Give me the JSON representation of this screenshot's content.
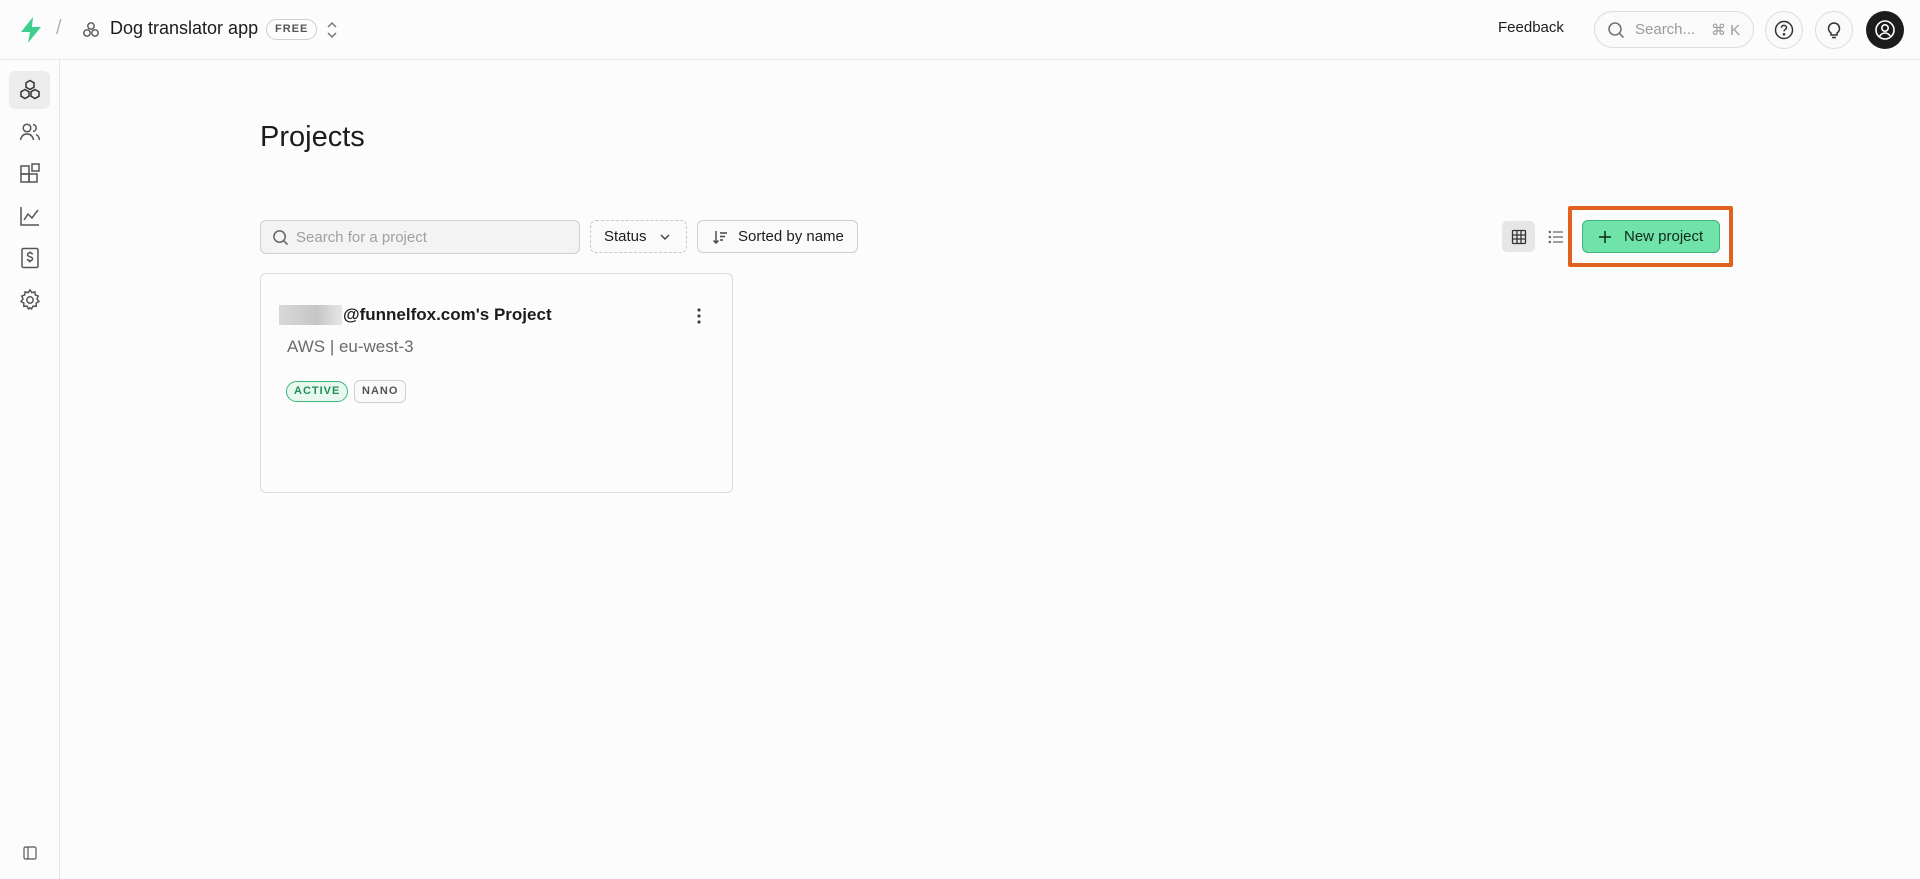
{
  "header": {
    "org_name": "Dog translator app",
    "plan_badge": "FREE",
    "feedback_label": "Feedback",
    "search_placeholder": "Search...",
    "search_shortcut": "⌘ K",
    "icons": [
      "bolt-logo-icon",
      "org-icon",
      "chevron-updown-icon",
      "search-icon",
      "help-icon",
      "lightbulb-icon",
      "user-avatar-icon"
    ]
  },
  "sidebar": {
    "items": [
      {
        "name": "projects",
        "icon": "cubes-icon",
        "active": true
      },
      {
        "name": "team",
        "icon": "users-icon",
        "active": false
      },
      {
        "name": "integrations",
        "icon": "blocks-icon",
        "active": false
      },
      {
        "name": "usage",
        "icon": "chart-icon",
        "active": false
      },
      {
        "name": "billing",
        "icon": "receipt-icon",
        "active": false
      },
      {
        "name": "settings",
        "icon": "gear-icon",
        "active": false
      }
    ],
    "footer_icon": "panel-toggle-icon"
  },
  "main": {
    "title": "Projects",
    "search_placeholder": "Search for a project",
    "status_filter_label": "Status",
    "sort_label": "Sorted by name",
    "new_project_label": "New project",
    "view_mode": "grid"
  },
  "projects": [
    {
      "title": "@funnelfox.com's Project",
      "subtitle": "AWS | eu-west-3",
      "status_badge": "ACTIVE",
      "size_badge": "NANO"
    }
  ],
  "colors": {
    "accent": "#6fe3a8",
    "accent_border": "#3bb57b",
    "highlight": "#e0621e",
    "logo": "#3ecf8e"
  }
}
